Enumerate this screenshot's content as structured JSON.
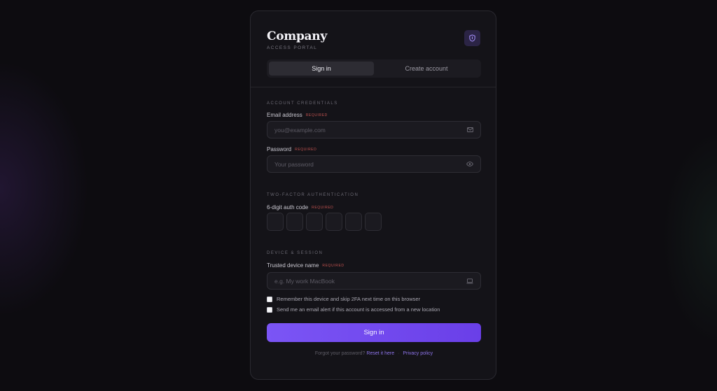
{
  "brand": {
    "name": "Company",
    "subtitle": "ACCESS PORTAL",
    "icon": "shield-icon"
  },
  "tabs": [
    {
      "label": "Sign in",
      "active": true
    },
    {
      "label": "Create account",
      "active": false
    }
  ],
  "credentials": {
    "section": "ACCOUNT CREDENTIALS",
    "email": {
      "label": "Email address",
      "required": "REQUIRED",
      "placeholder": "you@example.com",
      "value": "",
      "icon": "envelope-icon"
    },
    "password": {
      "label": "Password",
      "required": "REQUIRED",
      "placeholder": "Your password",
      "value": "",
      "icon": "eye-icon"
    }
  },
  "twofa": {
    "section": "TWO-FACTOR AUTHENTICATION",
    "label": "6-digit auth code",
    "required": "REQUIRED",
    "digits": [
      "",
      "",
      "",
      "",
      "",
      ""
    ]
  },
  "device": {
    "section": "DEVICE & SESSION",
    "label": "Trusted device name",
    "required": "REQUIRED",
    "placeholder": "e.g. My work MacBook",
    "value": "",
    "icon": "laptop-icon",
    "remember_label": "Remember this device and skip 2FA next time on this browser",
    "remember_checked": false,
    "alert_label": "Send me an email alert if this account is accessed from a new location",
    "alert_checked": false
  },
  "submit_label": "Sign in",
  "footer": {
    "prompt": "Forgot your password?",
    "reset_link": "Reset it here",
    "separator": "·",
    "privacy_link": "Privacy policy"
  },
  "colors": {
    "accent": "#7b55f5",
    "background": "#0d0c10",
    "card": "#141318",
    "required": "#c0524f"
  }
}
